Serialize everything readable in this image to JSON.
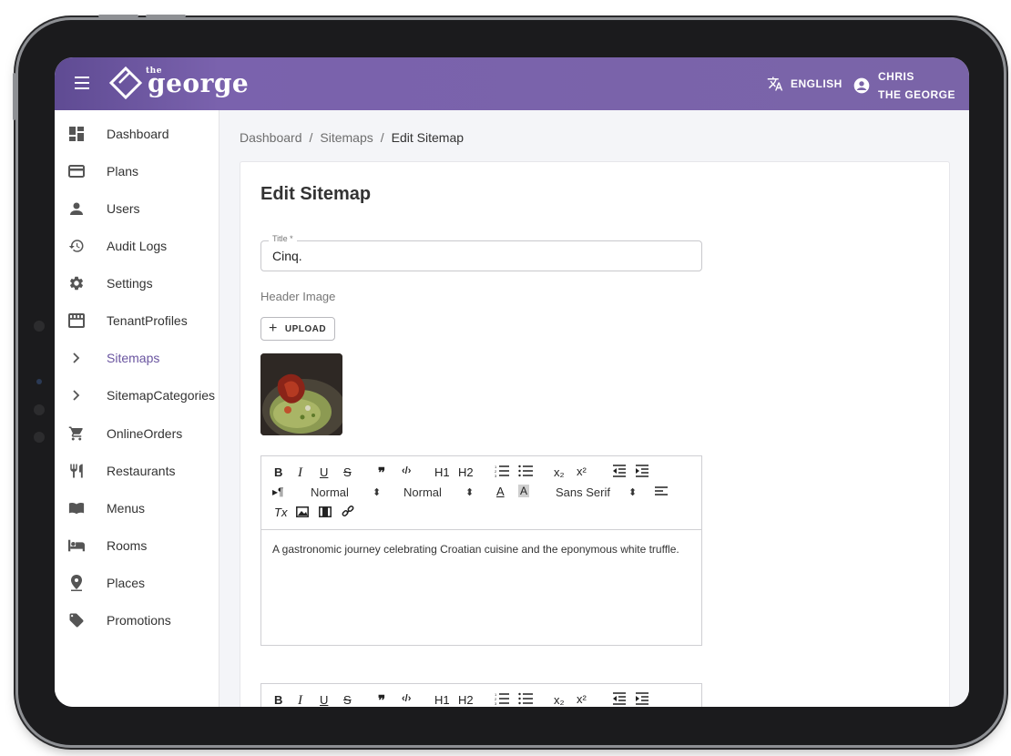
{
  "app": {
    "logo_small": "the",
    "logo_word": "george",
    "language": "ENGLISH",
    "user_line1": "CHRIS",
    "user_line2": "THE GEORGE",
    "accent": "#7a64a8"
  },
  "sidebar": {
    "items": [
      {
        "label": "Dashboard",
        "icon": "dashboard-icon"
      },
      {
        "label": "Plans",
        "icon": "card-icon"
      },
      {
        "label": "Users",
        "icon": "person-icon"
      },
      {
        "label": "Audit Logs",
        "icon": "history-icon"
      },
      {
        "label": "Settings",
        "icon": "gear-icon"
      },
      {
        "label": "TenantProfiles",
        "icon": "store-icon"
      },
      {
        "label": "Sitemaps",
        "icon": "chevron-right-icon"
      },
      {
        "label": "SitemapCategories",
        "icon": "chevron-right-icon"
      },
      {
        "label": "OnlineOrders",
        "icon": "cart-icon"
      },
      {
        "label": "Restaurants",
        "icon": "restaurant-icon"
      },
      {
        "label": "Menus",
        "icon": "book-icon"
      },
      {
        "label": "Rooms",
        "icon": "bed-icon"
      },
      {
        "label": "Places",
        "icon": "pin-icon"
      },
      {
        "label": "Promotions",
        "icon": "tag-icon"
      }
    ],
    "active": "Sitemaps"
  },
  "breadcrumb": {
    "items": [
      "Dashboard",
      "Sitemaps",
      "Edit Sitemap"
    ],
    "separator": "/"
  },
  "form": {
    "page_title": "Edit Sitemap",
    "title_label": "Title *",
    "title_value": "Cinq.",
    "header_image_label": "Header Image",
    "upload_label": "UPLOAD"
  },
  "editor": {
    "tb_bold": "B",
    "tb_italic": "I",
    "tb_underline": "U",
    "tb_strike": "S",
    "tb_quote": "❞",
    "tb_code": "‹/›",
    "tb_h1": "H1",
    "tb_h2": "H2",
    "tb_sub": "x₂",
    "tb_sup": "x²",
    "tb_direction": "▸¶",
    "size_select": "Normal",
    "header_select": "Normal",
    "font_select": "Sans Serif",
    "tb_clean": "Tx",
    "body_text": "A gastronomic journey celebrating Croatian cuisine and the eponymous white truffle."
  }
}
